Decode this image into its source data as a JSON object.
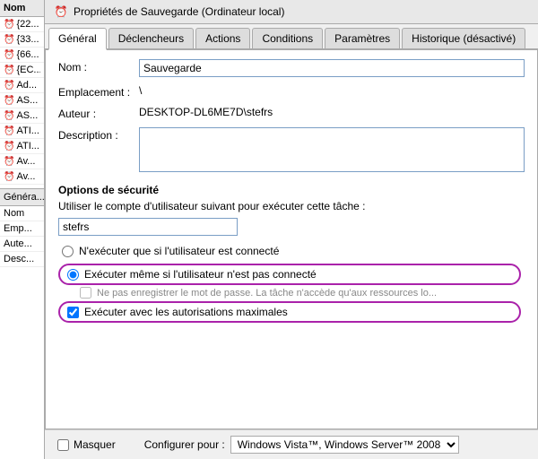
{
  "dialog": {
    "title": "Propriétés de Sauvegarde (Ordinateur local)",
    "title_icon": "⏰"
  },
  "tabs": [
    {
      "label": "Général",
      "active": true
    },
    {
      "label": "Déclencheurs",
      "active": false
    },
    {
      "label": "Actions",
      "active": false
    },
    {
      "label": "Conditions",
      "active": false
    },
    {
      "label": "Paramètres",
      "active": false
    },
    {
      "label": "Historique (désactivé)",
      "active": false
    }
  ],
  "form": {
    "nom_label": "Nom :",
    "nom_value": "Sauvegarde",
    "emplacement_label": "Emplacement :",
    "emplacement_value": "\\",
    "auteur_label": "Auteur :",
    "auteur_value": "DESKTOP-DL6ME7D\\stefrs",
    "description_label": "Description :",
    "description_value": ""
  },
  "security": {
    "section_title": "Options de sécurité",
    "section_desc": "Utiliser le compte d'utilisateur suivant pour exécuter cette tâche :",
    "user_value": "stefrs",
    "radio1_label": "N'exécuter que si l'utilisateur est connecté",
    "radio2_label": "Exécuter même si l'utilisateur n'est pas connecté",
    "sub_checkbox_label": "Ne pas enregistrer le mot de passe. La tâche n'accède qu'aux ressources lo...",
    "checkbox_max_label": "Exécuter avec les autorisations maximales",
    "checkbox_masquer_label": "Masquer",
    "configure_label": "Configurer pour :",
    "configure_value": "Windows Vista™, Windows Server™ 2008"
  },
  "sidebar": {
    "header_label": "Nom",
    "items": [
      {
        "icon": "⏰",
        "label": "{22..."
      },
      {
        "icon": "⏰",
        "label": "{33..."
      },
      {
        "icon": "⏰",
        "label": "{66..."
      },
      {
        "icon": "⏰",
        "label": "{EC..."
      },
      {
        "icon": "⏰",
        "label": "Ad..."
      },
      {
        "icon": "⏰",
        "label": "AS..."
      },
      {
        "icon": "⏰",
        "label": "AS..."
      },
      {
        "icon": "⏰",
        "label": "ATI..."
      },
      {
        "icon": "⏰",
        "label": "ATI..."
      },
      {
        "icon": "⏰",
        "label": "Av..."
      },
      {
        "icon": "⏰",
        "label": "Av..."
      }
    ],
    "bottom_header": "Généra...",
    "bottom_items": [
      {
        "label": "Nom"
      },
      {
        "label": "Emp..."
      },
      {
        "label": "Aute..."
      },
      {
        "label": "Desc..."
      }
    ]
  }
}
